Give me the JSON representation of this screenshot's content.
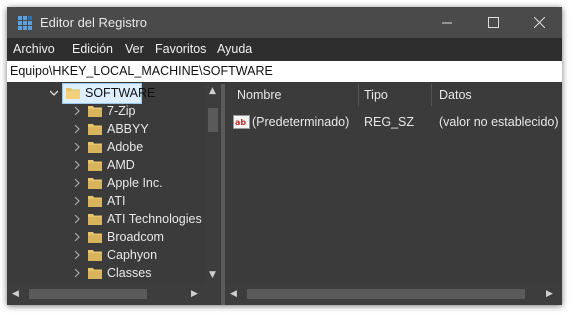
{
  "window": {
    "title": "Editor del Registro",
    "icon": "regedit-icon",
    "controls": [
      "minimize-icon",
      "maximize-icon",
      "close-icon"
    ]
  },
  "menu": [
    "Archivo",
    "Edición",
    "Ver",
    "Favoritos",
    "Ayuda"
  ],
  "address": "Equipo\\HKEY_LOCAL_MACHINE\\SOFTWARE",
  "tree": {
    "selected": "SOFTWARE",
    "children": [
      "7-Zip",
      "ABBYY",
      "Adobe",
      "AMD",
      "Apple Inc.",
      "ATI",
      "ATI Technologies",
      "Broadcom",
      "Caphyon",
      "Classes"
    ]
  },
  "list": {
    "columns": [
      "Nombre",
      "Tipo",
      "Datos"
    ],
    "rows": [
      {
        "name": "(Predeterminado)",
        "type": "REG_SZ",
        "data": "(valor no establecido)",
        "icon": "ab-string-icon"
      }
    ]
  },
  "colors": {
    "background": "#3b3b3b",
    "folder": "#e8c46a",
    "selection": "#ddeeff"
  }
}
